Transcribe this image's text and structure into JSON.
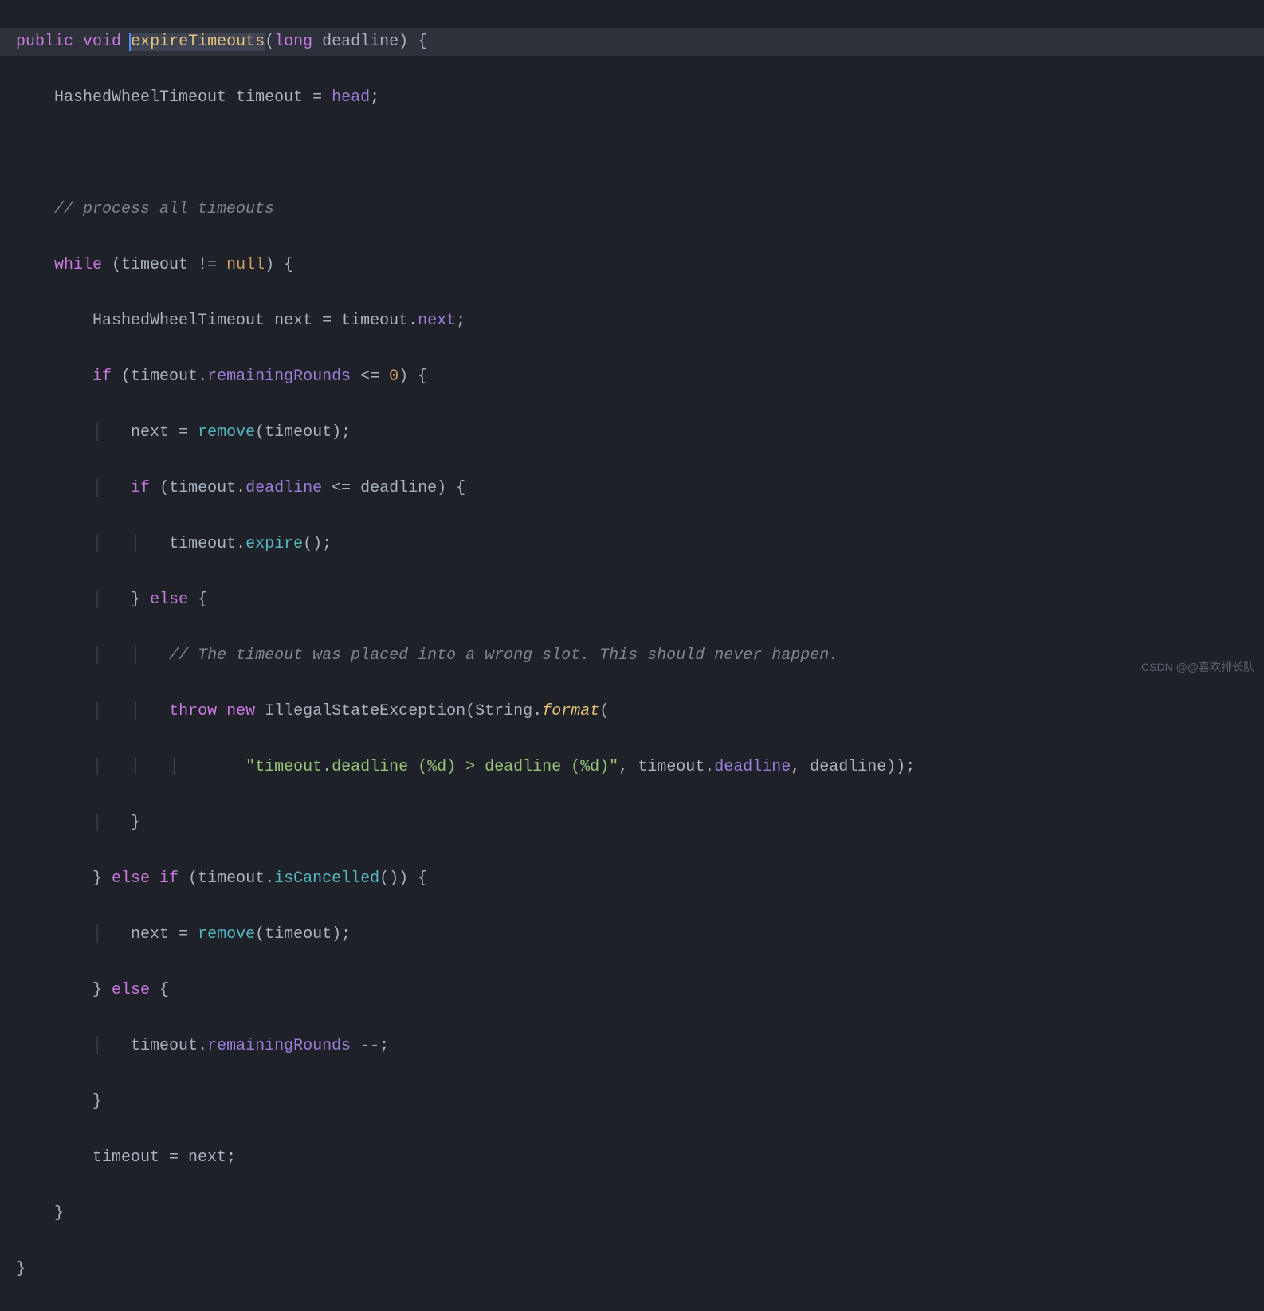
{
  "code": {
    "line1": {
      "kw_public": "public",
      "kw_void": "void",
      "method": "expireTimeouts",
      "kw_long": "long",
      "param": "deadline",
      "brace": " {"
    },
    "line2": {
      "type": "HashedWheelTimeout",
      "var": "timeout",
      "eq": " = ",
      "field": "head",
      "semi": ";"
    },
    "line3_comment": "// process all timeouts",
    "line4": {
      "kw_while": "while",
      "open": " (",
      "var": "timeout",
      "op": " != ",
      "null": "null",
      "close": ") {"
    },
    "line5": {
      "type": "HashedWheelTimeout",
      "var": "next",
      "eq": " = ",
      "obj": "timeout",
      "dot": ".",
      "field": "next",
      "semi": ";"
    },
    "line6": {
      "kw_if": "if",
      "open": " (",
      "obj": "timeout",
      "dot": ".",
      "field": "remainingRounds",
      "op": " <= ",
      "num": "0",
      "close": ") {"
    },
    "line7": {
      "var": "next",
      "eq": " = ",
      "call": "remove",
      "open": "(",
      "arg": "timeout",
      "close": ");"
    },
    "line8": {
      "kw_if": "if",
      "open": " (",
      "obj": "timeout",
      "dot": ".",
      "field": "deadline",
      "op": " <= ",
      "var": "deadline",
      "close": ") {"
    },
    "line9": {
      "obj": "timeout",
      "dot": ".",
      "call": "expire",
      "close": "();"
    },
    "line10": {
      "close": "}",
      "kw_else": " else ",
      "open": "{"
    },
    "line11_comment": "// The timeout was placed into a wrong slot. This should never happen.",
    "line12": {
      "kw_throw": "throw",
      "kw_new": " new ",
      "type": "IllegalStateException",
      "open": "(",
      "class": "String",
      "dot": ".",
      "call": "format",
      "close": "("
    },
    "line13": {
      "str": "\"timeout.deadline (%d) > deadline (%d)\"",
      "sep": ", ",
      "obj": "timeout",
      "dot": ".",
      "field": "deadline",
      "sep2": ", ",
      "var": "deadline",
      "close": "));"
    },
    "line14": "}",
    "line15": {
      "close": "}",
      "kw_else_if": " else if ",
      "open": "(",
      "obj": "timeout",
      "dot": ".",
      "call": "isCancelled",
      "close2": "()) {"
    },
    "line16": {
      "var": "next",
      "eq": " = ",
      "call": "remove",
      "open": "(",
      "arg": "timeout",
      "close": ");"
    },
    "line17": {
      "close": "}",
      "kw_else": " else ",
      "open": "{"
    },
    "line18": {
      "obj": "timeout",
      "dot": ".",
      "field": "remainingRounds",
      "op": " --;"
    },
    "line19": "}",
    "line20": {
      "var": "timeout",
      "eq": " = ",
      "var2": "next",
      "semi": ";"
    },
    "line21": "}",
    "line22": "}"
  },
  "watermark": "CSDN @@喜欢排长队"
}
